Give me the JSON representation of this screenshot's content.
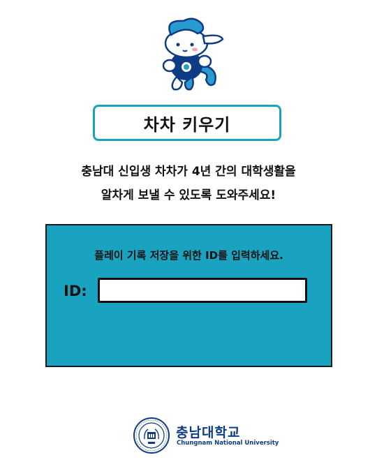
{
  "header": {
    "mascot_icon": "mascot-character-icon",
    "title": "차차 키우기"
  },
  "intro": {
    "line1": "충남대 신입생 차차가 4년 간의 대학생활을",
    "line2": "알차게 보낼 수 있도록 도와주세요!"
  },
  "login_panel": {
    "message": "플레이 기록 저장을 위한 ID를 입력하세요.",
    "id_label": "ID:",
    "id_value": "",
    "background_color": "#1aa3c0"
  },
  "footer": {
    "seal_icon": "university-seal-icon",
    "university_name_ko": "충남대학교",
    "university_name_en": "Chungnam National University",
    "brand_color": "#0d3c84"
  }
}
